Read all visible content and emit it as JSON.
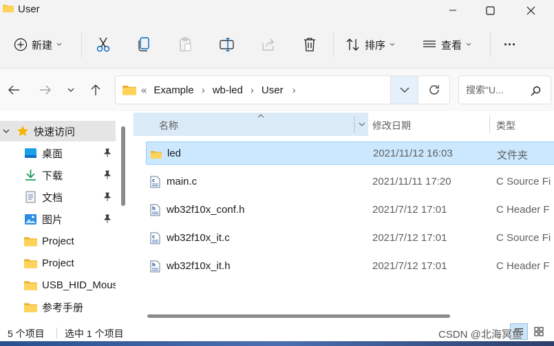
{
  "window": {
    "title": "User"
  },
  "toolbar": {
    "new_label": "新建",
    "sort_label": "排序",
    "view_label": "查看",
    "more_label": "···"
  },
  "address": {
    "overflow": "«",
    "crumbs": [
      "Example",
      "wb-led",
      "User"
    ],
    "separator": "›"
  },
  "search": {
    "placeholder": "搜索\"U..."
  },
  "nav": {
    "quick_access_label": "快速访问",
    "items": [
      {
        "label": "桌面",
        "icon": "desktop-icon"
      },
      {
        "label": "下载",
        "icon": "download-icon"
      },
      {
        "label": "文档",
        "icon": "document-icon"
      },
      {
        "label": "图片",
        "icon": "pictures-icon"
      },
      {
        "label": "Project",
        "icon": "folder-icon"
      },
      {
        "label": "Project",
        "icon": "folder-icon"
      },
      {
        "label": "USB_HID_Mous",
        "icon": "folder-icon"
      },
      {
        "label": "参考手册",
        "icon": "folder-icon"
      }
    ]
  },
  "columns": {
    "name": "名称",
    "date": "修改日期",
    "type": "类型"
  },
  "files": [
    {
      "name": "led",
      "date": "2021/11/12 16:03",
      "type": "文件夹",
      "kind": "folder"
    },
    {
      "name": "main.c",
      "date": "2021/11/11 17:20",
      "type": "C Source Fi",
      "kind": "c"
    },
    {
      "name": "wb32f10x_conf.h",
      "date": "2021/7/12 17:01",
      "type": "C Header F",
      "kind": "h"
    },
    {
      "name": "wb32f10x_it.c",
      "date": "2021/7/12 17:01",
      "type": "C Source Fi",
      "kind": "c"
    },
    {
      "name": "wb32f10x_it.h",
      "date": "2021/7/12 17:01",
      "type": "C Header F",
      "kind": "h"
    }
  ],
  "status": {
    "count": "5 个项目",
    "selected": "选中 1 个项目"
  },
  "watermark": "CSDN @北海冥鱼",
  "colors": {
    "accent": "#0067c0",
    "folder": "#f4c542",
    "selection": "#cce8ff"
  }
}
